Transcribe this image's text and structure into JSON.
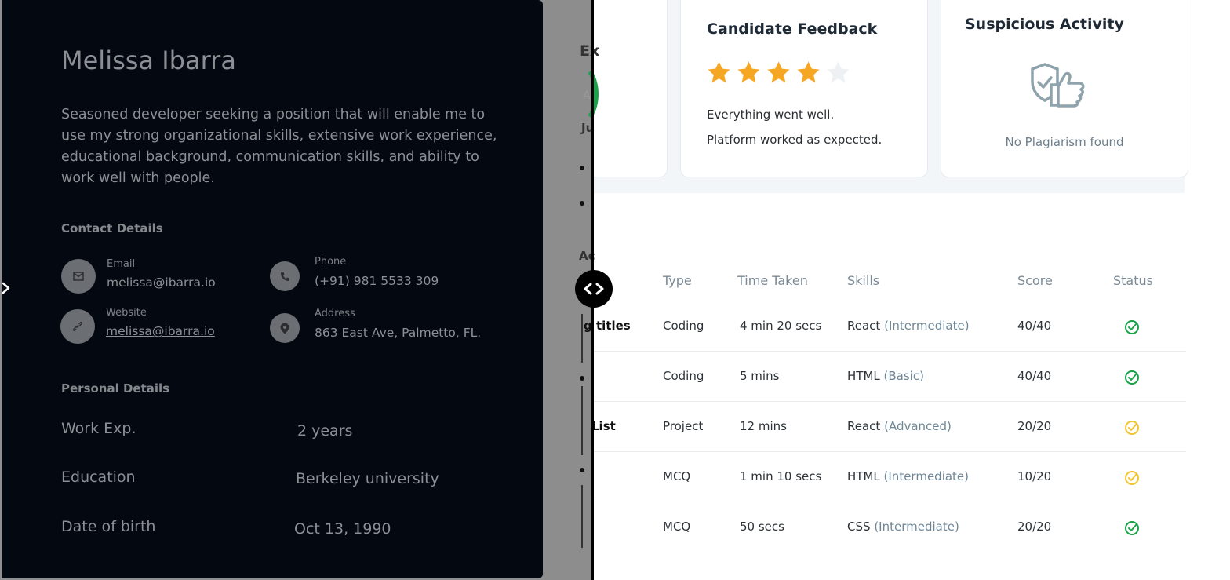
{
  "profile": {
    "name": "Melissa Ibarra",
    "bio": "Seasoned developer seeking a position that will enable me to use my strong organizational skills, extensive work experience, educational background, communication skills, and ability to work well with people."
  },
  "contact": {
    "title": "Contact Details",
    "email_label": "Email",
    "email_value": "melissa@ibarra.io",
    "phone_label": "Phone",
    "phone_value": "(+91) 981 5533 309",
    "website_label": "Website",
    "website_value": "melissa@ibarra.io",
    "address_label": "Address",
    "address_value": "863 East Ave, Palmetto, FL."
  },
  "personal": {
    "title": "Personal Details",
    "rows": [
      {
        "key": "Work Exp.",
        "value": "2 years"
      },
      {
        "key": "Education",
        "value": "Berkeley university"
      },
      {
        "key": "Date of birth",
        "value": "Oct 13, 1990"
      }
    ]
  },
  "partial_card": {
    "title_fragment": "Ex",
    "label_fragment": "A",
    "date_fragment": "Ju",
    "activity_fragment": "Ac"
  },
  "feedback": {
    "title": "Candidate Feedback",
    "rating": 4,
    "max_rating": 5,
    "line1": "Everything went well.",
    "line2": "Platform worked as expected."
  },
  "suspicious": {
    "title": "Suspicious Activity",
    "icon": "shield-thumbs-up-icon",
    "message": "No Plagiarism found"
  },
  "table": {
    "headers": [
      "Type",
      "Time Taken",
      "Skills",
      "Score",
      "Status"
    ],
    "rows": [
      {
        "title": "g titles",
        "type": "Coding",
        "time": "4 min 20 secs",
        "skill": "React",
        "level": "(Intermediate)",
        "score": "40/40",
        "status": "complete-green"
      },
      {
        "title": "",
        "type": "Coding",
        "time": "5 mins",
        "skill": "HTML",
        "level": "(Basic)",
        "score": "40/40",
        "status": "complete-green"
      },
      {
        "title": "List",
        "type": "Project",
        "time": "12 mins",
        "skill": "React",
        "level": "(Advanced)",
        "score": "20/20",
        "status": "partial-yellow"
      },
      {
        "title": "",
        "type": "MCQ",
        "time": "1 min 10 secs",
        "skill": "HTML",
        "level": "(Intermediate)",
        "score": "10/20",
        "status": "partial-yellow"
      },
      {
        "title": "",
        "type": "MCQ",
        "time": "50 secs",
        "skill": "CSS",
        "level": "(Intermediate)",
        "score": "20/20",
        "status": "complete-green"
      }
    ]
  },
  "colors": {
    "panel_bg": "#040810",
    "star_filled": "#f5a623",
    "star_empty": "#eef1f3",
    "status_green": "#1aa34a",
    "status_yellow": "#f4c430"
  }
}
